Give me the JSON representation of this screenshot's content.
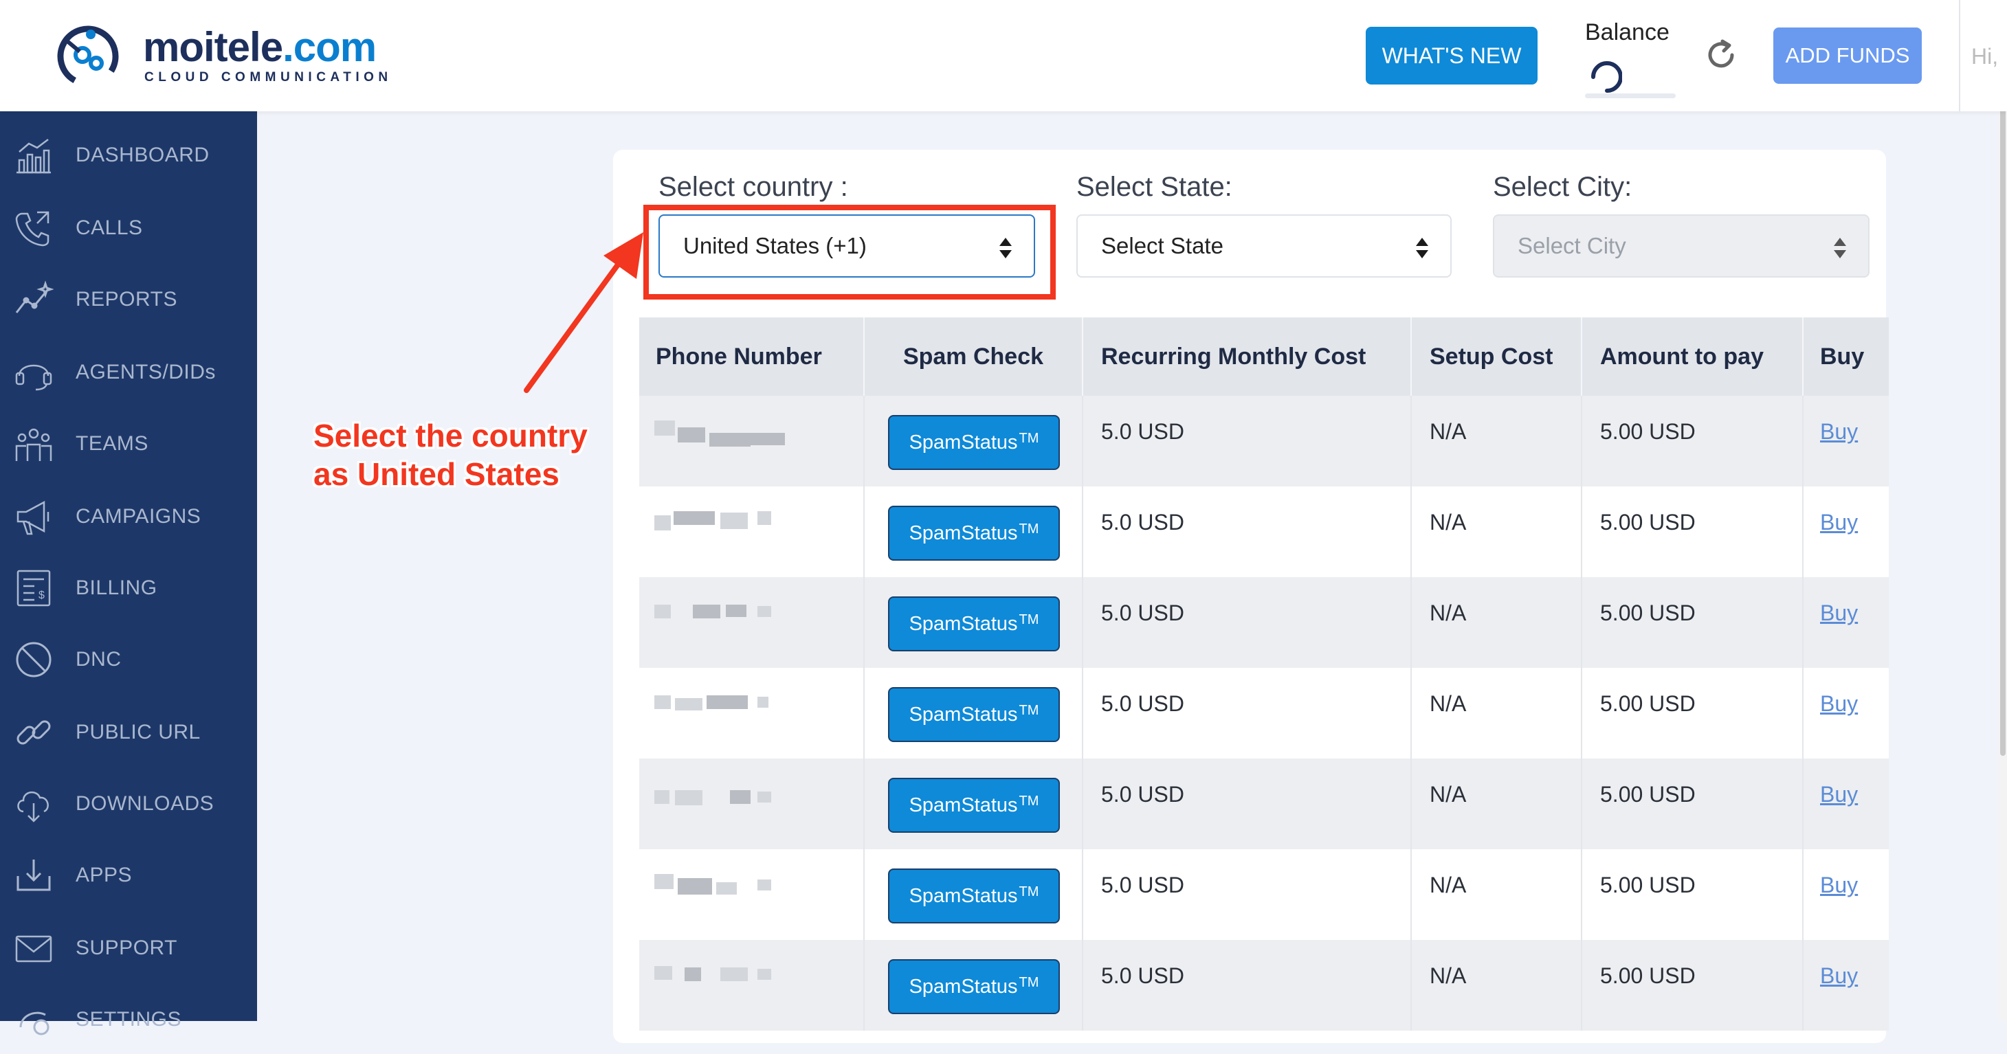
{
  "header": {
    "logo_main": "moitele",
    "logo_accent": ".com",
    "logo_tagline": "CLOUD COMMUNICATION",
    "whats_new_label": "WHAT'S NEW",
    "balance_label": "Balance",
    "add_funds_label": "ADD FUNDS",
    "greeting": "Hi,"
  },
  "sidebar": {
    "items": [
      {
        "label": "DASHBOARD",
        "icon": "dashboard-chart-icon"
      },
      {
        "label": "CALLS",
        "icon": "phone-icon"
      },
      {
        "label": "REPORTS",
        "icon": "trend-line-icon"
      },
      {
        "label": "AGENTS/DIDs",
        "icon": "headset-icon"
      },
      {
        "label": "TEAMS",
        "icon": "team-icon"
      },
      {
        "label": "CAMPAIGNS",
        "icon": "megaphone-icon"
      },
      {
        "label": "BILLING",
        "icon": "invoice-icon"
      },
      {
        "label": "DNC",
        "icon": "prohibited-icon"
      },
      {
        "label": "PUBLIC URL",
        "icon": "link-icon"
      },
      {
        "label": "DOWNLOADS",
        "icon": "cloud-download-icon"
      },
      {
        "label": "APPS",
        "icon": "download-tray-icon"
      },
      {
        "label": "SUPPORT",
        "icon": "envelope-icon"
      },
      {
        "label": "SETTINGS",
        "icon": "settings-icon"
      }
    ]
  },
  "filters": {
    "country_label": "Select country :",
    "country_value": "United States (+1)",
    "state_label": "Select State:",
    "state_value": "Select State",
    "city_label": "Select City:",
    "city_value": "Select City"
  },
  "table": {
    "headers": [
      "Phone Number",
      "Spam Check",
      "Recurring Monthly Cost",
      "Setup Cost",
      "Amount to pay",
      "Buy"
    ],
    "spam_label": "SpamStatus",
    "spam_sup": "TM",
    "rows": [
      {
        "monthly": "5.0 USD",
        "setup": "N/A",
        "amount": "5.00 USD",
        "buy": "Buy"
      },
      {
        "monthly": "5.0 USD",
        "setup": "N/A",
        "amount": "5.00 USD",
        "buy": "Buy"
      },
      {
        "monthly": "5.0 USD",
        "setup": "N/A",
        "amount": "5.00 USD",
        "buy": "Buy"
      },
      {
        "monthly": "5.0 USD",
        "setup": "N/A",
        "amount": "5.00 USD",
        "buy": "Buy"
      },
      {
        "monthly": "5.0 USD",
        "setup": "N/A",
        "amount": "5.00 USD",
        "buy": "Buy"
      },
      {
        "monthly": "5.0 USD",
        "setup": "N/A",
        "amount": "5.00 USD",
        "buy": "Buy"
      },
      {
        "monthly": "5.0 USD",
        "setup": "N/A",
        "amount": "5.00 USD",
        "buy": "Buy"
      }
    ]
  },
  "annotation": {
    "line1": "Select the country",
    "line2": "as United States",
    "color": "#f2361f"
  },
  "colors": {
    "primary": "#0e8ad8",
    "sidebar": "#1d3868",
    "add_funds": "#6a9af0"
  }
}
